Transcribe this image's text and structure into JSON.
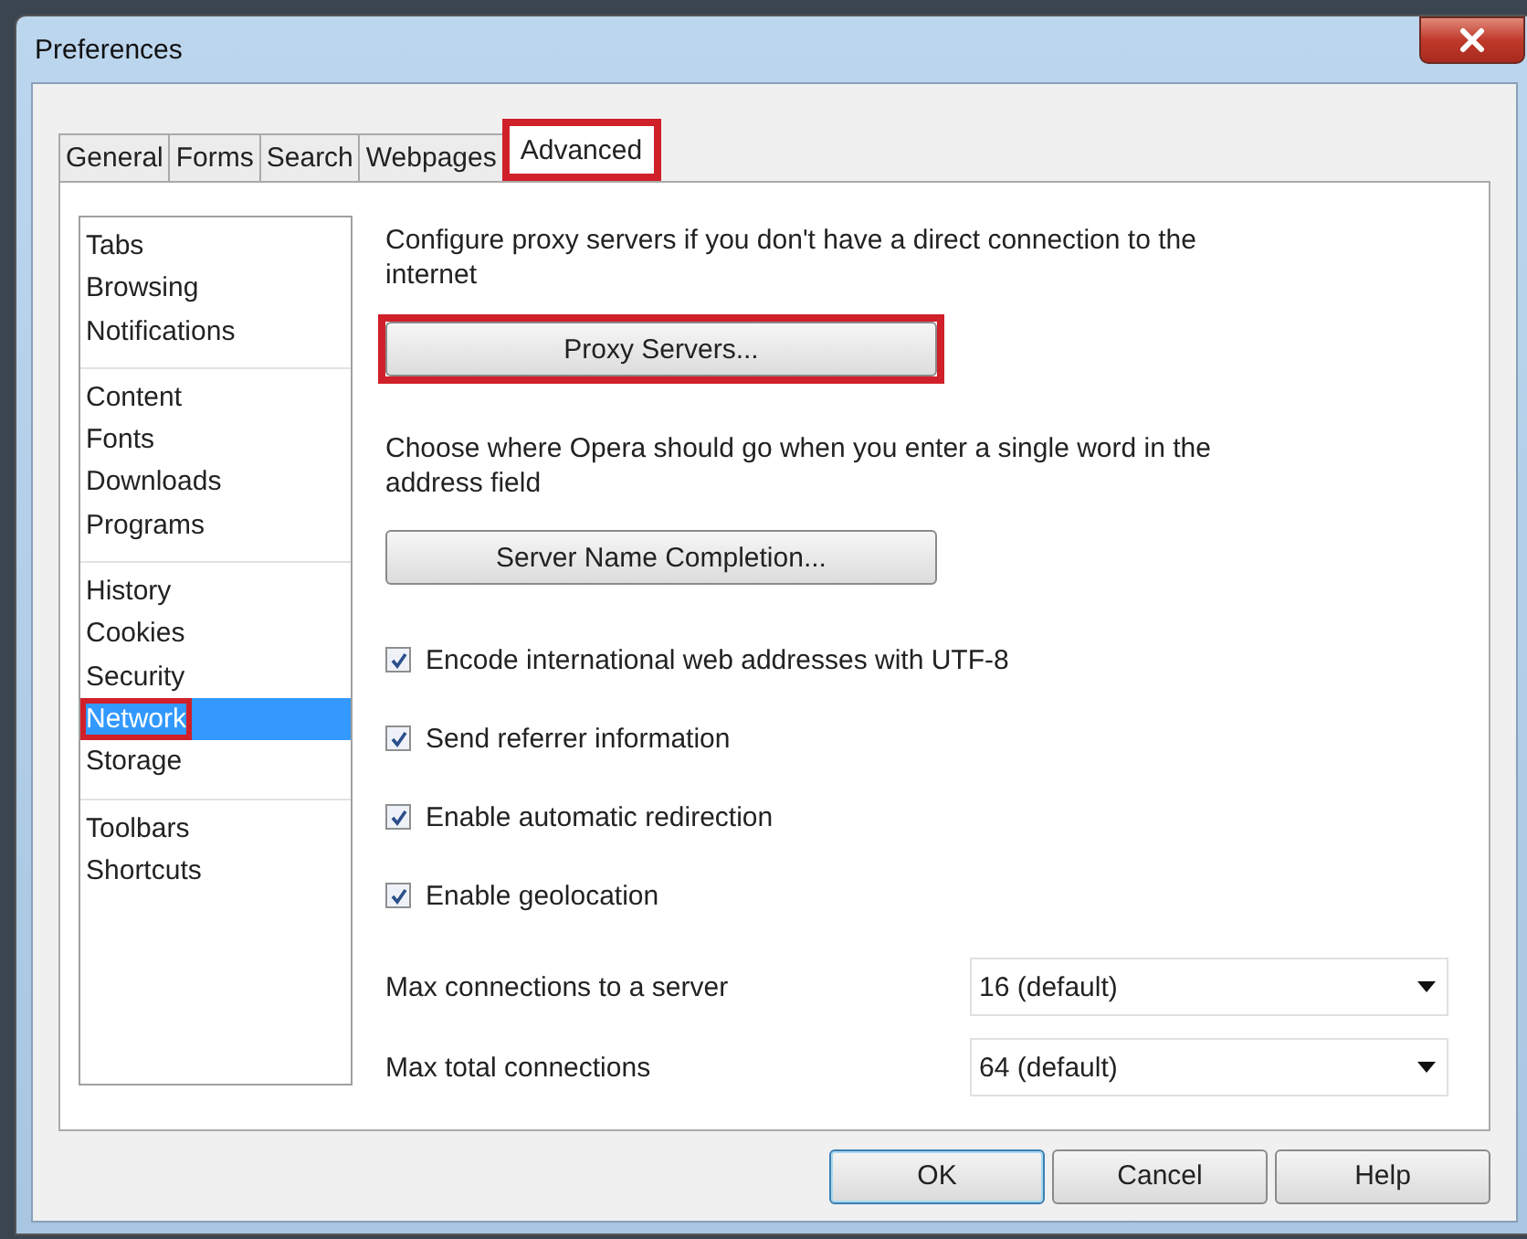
{
  "window": {
    "title": "Preferences"
  },
  "tabs": [
    {
      "label": "General",
      "selected": false,
      "highlighted": false
    },
    {
      "label": "Forms",
      "selected": false,
      "highlighted": false
    },
    {
      "label": "Search",
      "selected": false,
      "highlighted": false
    },
    {
      "label": "Webpages",
      "selected": false,
      "highlighted": false
    },
    {
      "label": "Advanced",
      "selected": true,
      "highlighted": true
    }
  ],
  "sidebar": {
    "groups": [
      {
        "items": [
          {
            "label": "Tabs",
            "selected": false,
            "highlighted": false
          },
          {
            "label": "Browsing",
            "selected": false,
            "highlighted": false
          },
          {
            "label": "Notifications",
            "selected": false,
            "highlighted": false
          }
        ]
      },
      {
        "items": [
          {
            "label": "Content",
            "selected": false,
            "highlighted": false
          },
          {
            "label": "Fonts",
            "selected": false,
            "highlighted": false
          },
          {
            "label": "Downloads",
            "selected": false,
            "highlighted": false
          },
          {
            "label": "Programs",
            "selected": false,
            "highlighted": false
          }
        ]
      },
      {
        "items": [
          {
            "label": "History",
            "selected": false,
            "highlighted": false
          },
          {
            "label": "Cookies",
            "selected": false,
            "highlighted": false
          },
          {
            "label": "Security",
            "selected": false,
            "highlighted": false
          },
          {
            "label": "Network",
            "selected": true,
            "highlighted": true
          },
          {
            "label": "Storage",
            "selected": false,
            "highlighted": false
          }
        ]
      },
      {
        "items": [
          {
            "label": "Toolbars",
            "selected": false,
            "highlighted": false
          },
          {
            "label": "Shortcuts",
            "selected": false,
            "highlighted": false
          }
        ]
      }
    ]
  },
  "settings": [
    {
      "kind": "text",
      "text": "Configure proxy servers if you don't have a direct connection to the internet"
    },
    {
      "kind": "button",
      "label": "Proxy Servers...",
      "highlighted": true
    },
    {
      "kind": "text",
      "text": "Choose where Opera should go when you enter a single word in the address field"
    },
    {
      "kind": "button",
      "label": "Server Name Completion...",
      "highlighted": false
    },
    {
      "kind": "checkbox",
      "label": "Encode international web addresses with UTF-8",
      "checked": true
    },
    {
      "kind": "checkbox",
      "label": "Send referrer information",
      "checked": true
    },
    {
      "kind": "checkbox",
      "label": "Enable automatic redirection",
      "checked": true
    },
    {
      "kind": "checkbox",
      "label": "Enable geolocation",
      "checked": true
    },
    {
      "kind": "select",
      "label": "Max connections to a server",
      "value": "16 (default)"
    },
    {
      "kind": "select",
      "label": "Max total connections",
      "value": "64 (default)"
    }
  ],
  "buttons": [
    {
      "label": "OK",
      "default": true
    },
    {
      "label": "Cancel",
      "default": false
    },
    {
      "label": "Help",
      "default": false
    }
  ]
}
